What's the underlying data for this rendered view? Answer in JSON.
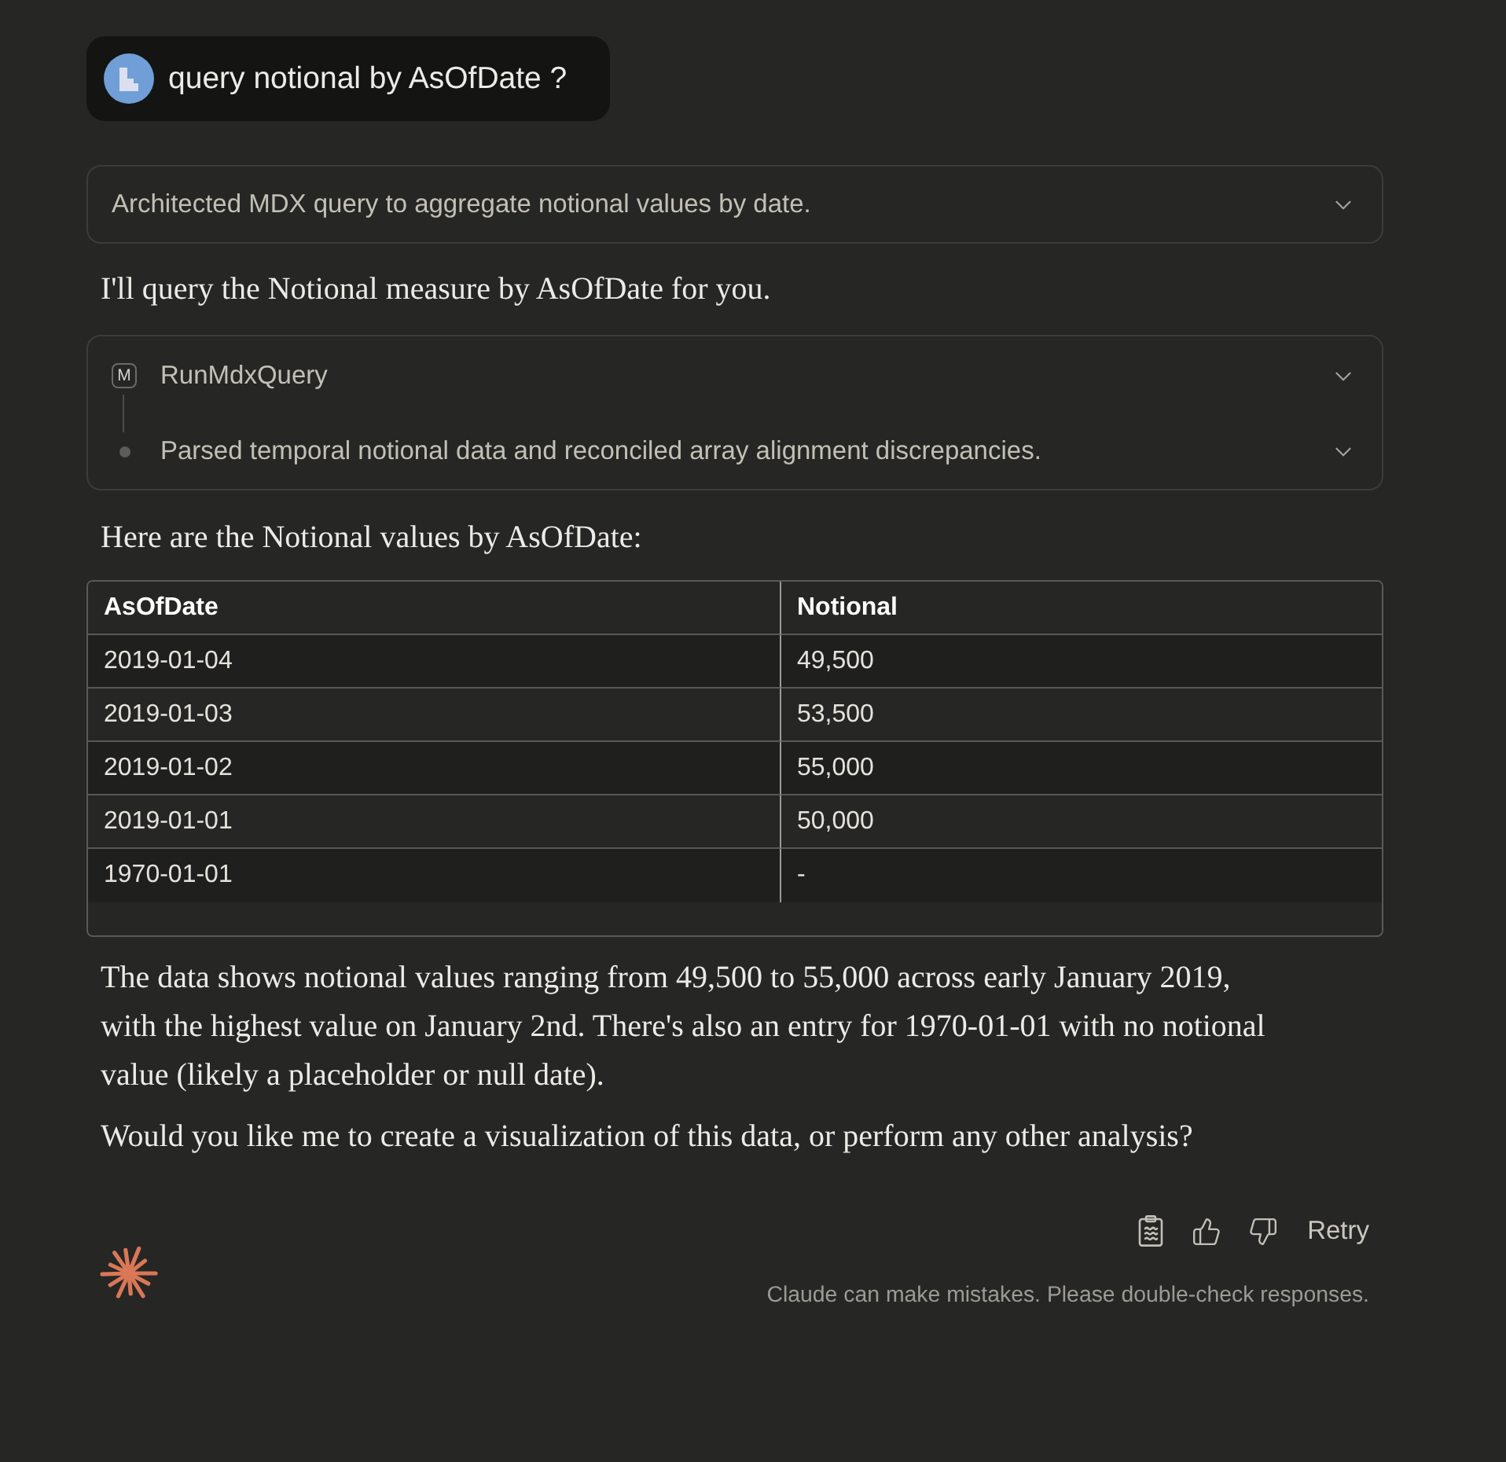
{
  "user_message": {
    "text": "query notional by AsOfDate ?"
  },
  "thinking": {
    "summary": "Architected MDX query to aggregate notional values by date.",
    "expanded": false
  },
  "intro": "I'll query the Notional measure by AsOfDate for you.",
  "tool_call": {
    "steps": [
      {
        "kind": "tool",
        "badge": "M",
        "label": "RunMdxQuery",
        "expanded": false
      },
      {
        "kind": "result",
        "label": "Parsed temporal notional data and reconciled array alignment discrepancies.",
        "expanded": false
      }
    ]
  },
  "table_intro": "Here are the Notional values by AsOfDate:",
  "table": {
    "columns": [
      "AsOfDate",
      "Notional"
    ],
    "rows": [
      [
        "2019-01-04",
        "49,500"
      ],
      [
        "2019-01-03",
        "53,500"
      ],
      [
        "2019-01-02",
        "55,000"
      ],
      [
        "2019-01-01",
        "50,000"
      ],
      [
        "1970-01-01",
        "-"
      ]
    ]
  },
  "paragraphs": [
    "The data shows notional values ranging from 49,500 to 55,000 across early January 2019, with the highest value on January 2nd. There's also an entry for 1970-01-01 with no notional value (likely a placeholder or null date).",
    "Would you like me to create a visualization of this data, or perform any other analysis?"
  ],
  "actions": [
    {
      "kind": "copy"
    },
    {
      "kind": "thumbs_up"
    },
    {
      "kind": "thumbs_down"
    },
    {
      "kind": "retry",
      "label": "Retry"
    }
  ],
  "disclaimer": "Claude can make mistakes. Please double-check responses."
}
